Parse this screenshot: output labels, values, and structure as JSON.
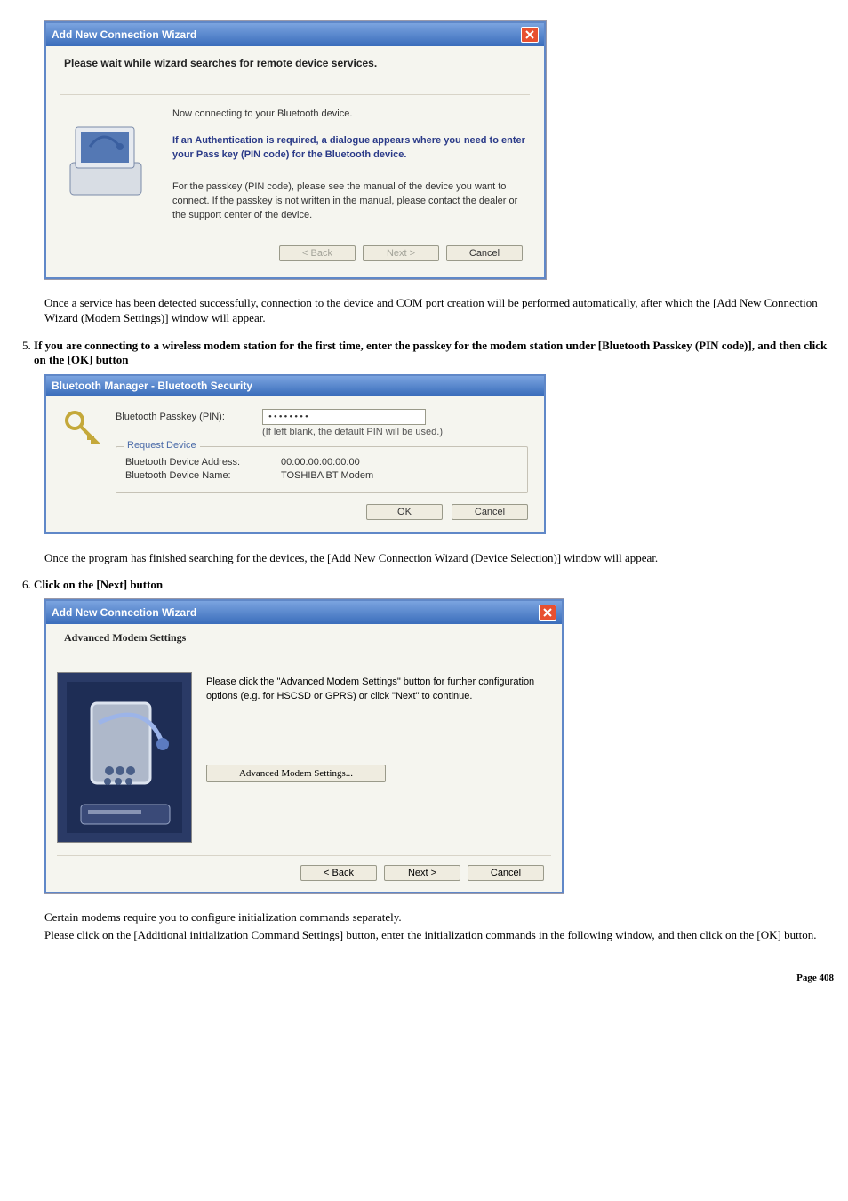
{
  "dlg1": {
    "title": "Add New Connection Wizard",
    "heading": "Please wait while wizard searches for remote device services.",
    "line1": "Now connecting to your Bluetooth device.",
    "bold1": "If an Authentication is required, a dialogue appears where you need to enter your Pass key (PIN code) for the Bluetooth device.",
    "para2": "For the passkey (PIN code), please see the manual of the device you want to connect. If the passkey is not written in the manual, please contact the dealer or the support center of the device.",
    "back": "< Back",
    "next": "Next >",
    "cancel": "Cancel"
  },
  "body1": "Once a service has been detected successfully, connection to the device and COM port creation will be performed automatically, after which the [Add New Connection Wizard (Modem Settings)] window will appear.",
  "step5": "If you are connecting to a wireless modem station for the first time, enter the passkey for the modem station under [Bluetooth Passkey (PIN code)], and then click on the [OK] button",
  "bt": {
    "title": "Bluetooth Manager - Bluetooth Security",
    "pinlabel": "Bluetooth Passkey (PIN):",
    "pinmask": "••••••••",
    "hint": "(If left blank, the default PIN will be used.)",
    "group": "Request Device",
    "addr_k": "Bluetooth Device Address:",
    "addr_v": "00:00:00:00:00:00",
    "name_k": "Bluetooth Device Name:",
    "name_v": "TOSHIBA BT Modem",
    "ok": "OK",
    "cancel": "Cancel"
  },
  "body2": "Once the program has finished searching for the devices, the [Add New Connection Wizard (Device Selection)] window will appear.",
  "step6": "Click on the [Next] button",
  "dlg3": {
    "title": "Add New Connection Wizard",
    "heading": "Advanced Modem Settings",
    "para": "Please click the \"Advanced Modem Settings\" button for further configuration options (e.g. for HSCSD or GPRS) or click \"Next\" to continue.",
    "advbtn": "Advanced Modem Settings...",
    "back": "< Back",
    "next": "Next >",
    "cancel": "Cancel"
  },
  "body3a": "Certain modems require you to configure initialization commands separately.",
  "body3b": "Please click on the [Additional initialization Command Settings] button, enter the initialization commands in the following window, and then click on the [OK] button.",
  "pagefoot": "Page 408"
}
